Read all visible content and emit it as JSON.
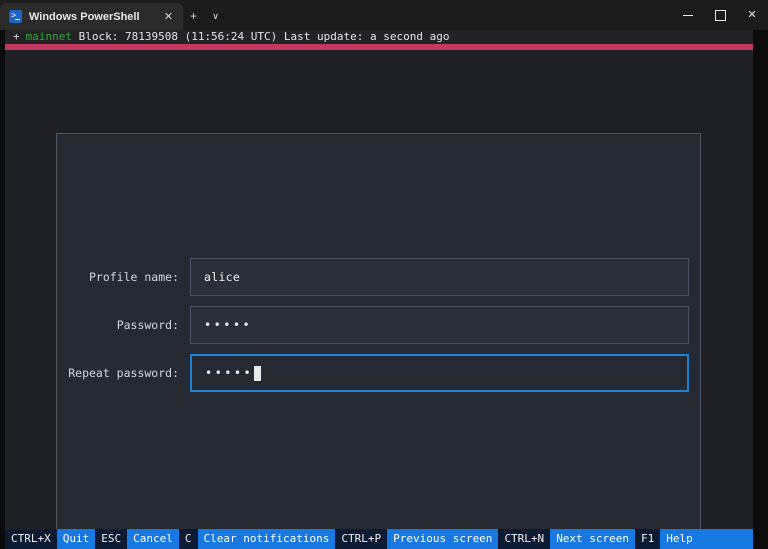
{
  "window": {
    "tab_title": "Windows PowerShell",
    "tab_icon": "powershell-icon",
    "close_label": "✕",
    "new_tab_label": "+",
    "dropdown_label": "∨",
    "minimize_label": "",
    "maximize_label": "",
    "window_close_label": "✕"
  },
  "statusline": {
    "prefix": "+",
    "network": "mainnet",
    "text": "Block: 78139508 (11:56:24 UTC) Last update: a second ago",
    "accent_color": "#c1395e",
    "network_color": "#37a137"
  },
  "form": {
    "fields": [
      {
        "label": "Profile name:",
        "value": "alice",
        "masked": false,
        "focused": false,
        "name": "profile-name"
      },
      {
        "label": "Password:",
        "value": "•••••",
        "masked": true,
        "focused": false,
        "name": "password"
      },
      {
        "label": "Repeat password:",
        "value": "•••••",
        "masked": true,
        "focused": true,
        "name": "repeat-password"
      }
    ],
    "focus_color": "#1f7fd0"
  },
  "keybar": {
    "items": [
      {
        "key": "CTRL+X",
        "action": "Quit"
      },
      {
        "key": "ESC",
        "action": "Cancel"
      },
      {
        "key": "C",
        "action": "Clear notifications"
      },
      {
        "key": "CTRL+P",
        "action": "Previous screen"
      },
      {
        "key": "CTRL+N",
        "action": "Next screen"
      },
      {
        "key": "F1",
        "action": "Help"
      }
    ],
    "key_bg": "#0d1a33",
    "action_bg": "#1678e0"
  }
}
